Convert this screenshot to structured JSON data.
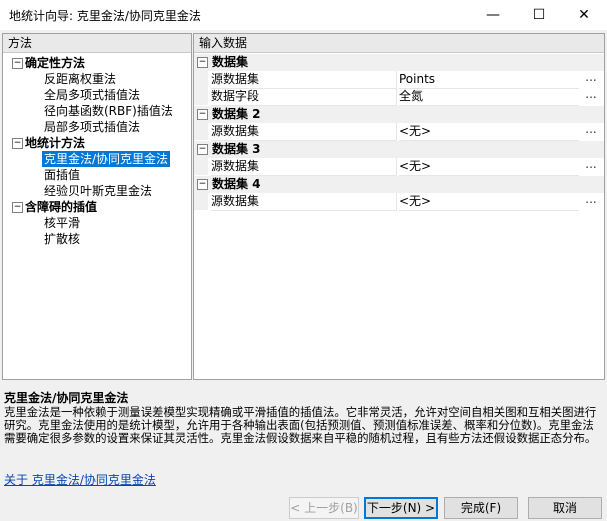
{
  "window": {
    "title": "地统计向导: 克里金法/协同克里金法",
    "minimize": "—",
    "maximize": "☐",
    "close": "✕"
  },
  "left": {
    "header": "方法",
    "groups": [
      {
        "label": "确定性方法",
        "expander": "−",
        "items": [
          "反距离权重法",
          "全局多项式插值法",
          "径向基函数(RBF)插值法",
          "局部多项式插值法"
        ]
      },
      {
        "label": "地统计方法",
        "expander": "−",
        "items": [
          "克里金法/协同克里金法",
          "面插值",
          "经验贝叶斯克里金法"
        ]
      },
      {
        "label": "含障碍的插值",
        "expander": "−",
        "items": [
          "核平滑",
          "扩散核"
        ]
      }
    ],
    "selected_item": "克里金法/协同克里金法"
  },
  "right": {
    "header": "输入数据",
    "datasets": [
      {
        "label": "数据集",
        "props": [
          {
            "name": "源数据集",
            "value": "Points"
          },
          {
            "name": "数据字段",
            "value": "全氮"
          }
        ]
      },
      {
        "label": "数据集 2",
        "props": [
          {
            "name": "源数据集",
            "value": "<无>"
          }
        ]
      },
      {
        "label": "数据集 3",
        "props": [
          {
            "name": "源数据集",
            "value": "<无>"
          }
        ]
      },
      {
        "label": "数据集 4",
        "props": [
          {
            "name": "源数据集",
            "value": "<无>"
          }
        ]
      }
    ],
    "ellipsis": "..."
  },
  "description": {
    "title": "克里金法/协同克里金法",
    "text": "克里金法是一种依赖于测量误差模型实现精确或平滑插值的插值法。它非常灵活，允许对空间自相关图和互相关图进行研究。克里金法使用的是统计模型，允许用于各种输出表面(包括预测值、预测值标准误差、概率和分位数)。克里金法需要确定很多参数的设置来保证其灵活性。克里金法假设数据来自平稳的随机过程，且有些方法还假设数据正态分布。",
    "link": "关于 克里金法/协同克里金法"
  },
  "buttons": {
    "prev": "< 上一步(B)",
    "next": "下一步(N) >",
    "finish": "完成(F)",
    "cancel": "取消"
  }
}
